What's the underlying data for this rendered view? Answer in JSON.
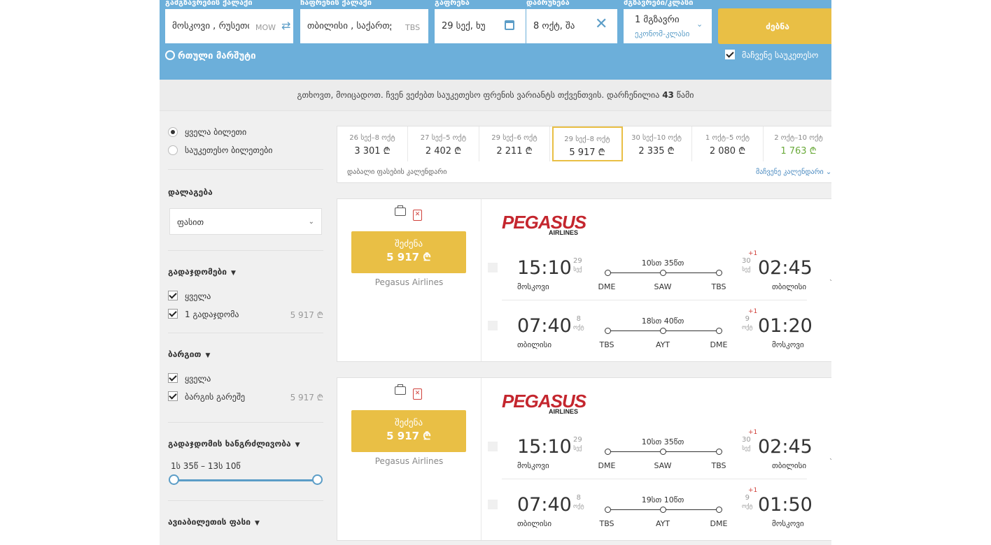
{
  "search": {
    "origin_label": "გამგზავრების ქალაქი",
    "origin_value": "მოსკოვი , რუსეთი",
    "origin_code": "MOW",
    "dest_label": "ჩაფრენის ქალაქი",
    "dest_value": "თბილისი , საქართველო",
    "dest_code": "TBS",
    "depart_label": "გაფრენა",
    "depart_value": "29 სექ, ხუ",
    "return_label": "დაბრუნება",
    "return_value": "8 ოქტ, შა",
    "pax_label": "მგზავრები/კლასი",
    "pax_value": "1 მგზავრი",
    "class_value": "ეკონომ-კლასი",
    "search_button": "ძებნა",
    "complex_route": "რთული მარშუტი",
    "show_best": "მაჩვენე საუკეთესო"
  },
  "wait_message": {
    "text": "გთხოვთ, მოიცადოთ. ჩვენ ვეძებთ საუკეთესო ფრენის ვარიანტს თქვენთვის. დარჩენილია",
    "seconds": "43",
    "unit": "წამი"
  },
  "filters": {
    "all_tickets": "ყველა ბილეთი",
    "best_tickets": "საუკეთესო ბილეთები",
    "sort_heading": "დალაგება",
    "sort_value": "ფასით",
    "stops_heading": "გადაჯდომები",
    "stops_all": "ყველა",
    "stops_one": "1 გადაჯდომა",
    "stops_one_price": "5 917 ₾",
    "baggage_heading": "ბარგით",
    "baggage_all": "ყველა",
    "baggage_none": "ბარგის გარეშე",
    "baggage_none_price": "5 917 ₾",
    "layover_heading": "გადაჯდომის ხანგრძლივობა",
    "layover_range": "1ს 35წ – 13ს 10წ",
    "price_heading": "ავიაბილეთის ფასი"
  },
  "calendar": {
    "cells": [
      {
        "dates": "26 სექ–8 ოქტ",
        "price": "3 301 ₾"
      },
      {
        "dates": "27 სექ–5 ოქტ",
        "price": "2 402 ₾"
      },
      {
        "dates": "29 სექ–6 ოქტ",
        "price": "2 211 ₾"
      },
      {
        "dates": "29 სექ–8 ოქტ",
        "price": "5 917 ₾"
      },
      {
        "dates": "30 სექ–10 ოქტ",
        "price": "2 335 ₾"
      },
      {
        "dates": "1 ოქტ–5 ოქტ",
        "price": "2 080 ₾"
      },
      {
        "dates": "2 ოქტ–10 ოქტ",
        "price": "1 763 ₾"
      }
    ],
    "footer_left": "დაბალი ფასების კალენდარი",
    "footer_right": "მაჩვენე კალენდარი"
  },
  "results": [
    {
      "buy_label": "შეძენა",
      "price": "5 917 ₾",
      "airline": "Pegasus Airlines",
      "logo_main": "PEGASUS",
      "logo_sub": "AIRLINES",
      "segments": [
        {
          "dep_time": "15:10",
          "dep_day": "29",
          "dep_month": "სექ",
          "dep_city": "მოსკოვი",
          "duration": "10სთ 35წთ",
          "from": "DME",
          "via": "SAW",
          "to": "TBS",
          "plus": "+1",
          "arr_day": "30",
          "arr_month": "სექ",
          "arr_time": "02:45",
          "arr_city": "თბილისი"
        },
        {
          "dep_time": "07:40",
          "dep_day": "8",
          "dep_month": "ოქტ",
          "dep_city": "თბილისი",
          "duration": "18სთ 40წთ",
          "from": "TBS",
          "via": "AYT",
          "to": "DME",
          "plus": "+1",
          "arr_day": "9",
          "arr_month": "ოქტ",
          "arr_time": "01:20",
          "arr_city": "მოსკოვი"
        }
      ]
    },
    {
      "buy_label": "შეძენა",
      "price": "5 917 ₾",
      "airline": "Pegasus Airlines",
      "logo_main": "PEGASUS",
      "logo_sub": "AIRLINES",
      "segments": [
        {
          "dep_time": "15:10",
          "dep_day": "29",
          "dep_month": "სექ",
          "dep_city": "მოსკოვი",
          "duration": "10სთ 35წთ",
          "from": "DME",
          "via": "SAW",
          "to": "TBS",
          "plus": "+1",
          "arr_day": "30",
          "arr_month": "სექ",
          "arr_time": "02:45",
          "arr_city": "თბილისი"
        },
        {
          "dep_time": "07:40",
          "dep_day": "8",
          "dep_month": "ოქტ",
          "dep_city": "თბილისი",
          "duration": "19სთ 10წთ",
          "from": "TBS",
          "via": "AYT",
          "to": "DME",
          "plus": "+1",
          "arr_day": "9",
          "arr_month": "ოქტ",
          "arr_time": "01:50",
          "arr_city": "მოსკოვი"
        }
      ]
    }
  ],
  "colors": {
    "topbar": "#6cafda",
    "accent": "#e9bf45",
    "cheap": "#6aaa3a",
    "brand": "#c4262e"
  }
}
